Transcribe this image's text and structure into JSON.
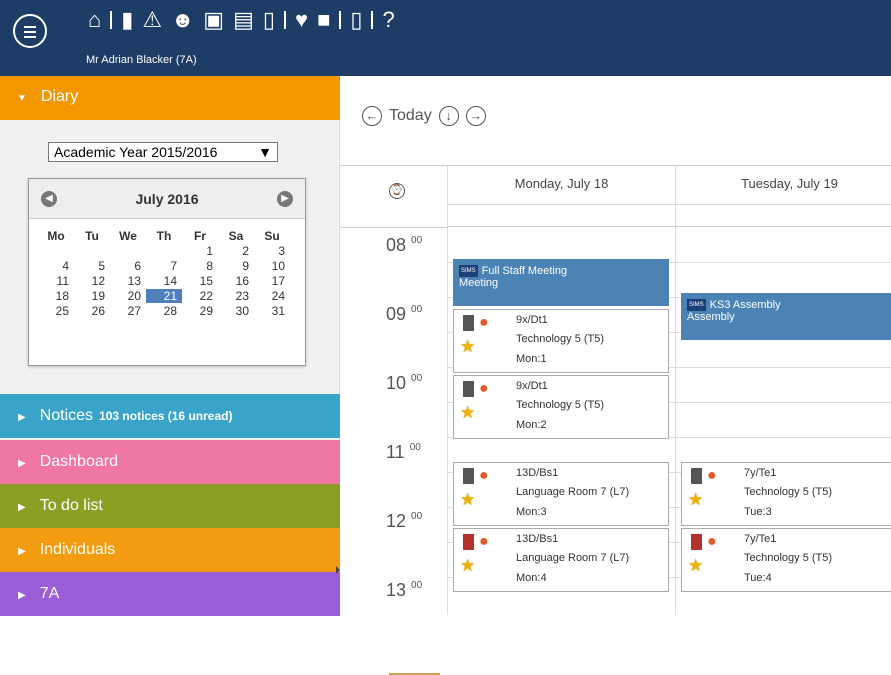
{
  "header": {
    "user": "Mr Adrian Blacker (7A)",
    "icons": [
      "home-icon",
      "book-icon",
      "warning-icon",
      "people-icon",
      "calendar-icon",
      "printer-icon",
      "phone-icon",
      "heart-icon",
      "square-icon",
      "door-icon",
      "help-icon"
    ]
  },
  "sidebar": {
    "diary_label": "Diary",
    "academic_year": "Academic Year 2015/2016",
    "calendar": {
      "month": "July 2016",
      "weekdays": [
        "Mo",
        "Tu",
        "We",
        "Th",
        "Fr",
        "Sa",
        "Su"
      ],
      "days": [
        "",
        "",
        "",
        "",
        "1",
        "2",
        "3",
        "4",
        "5",
        "6",
        "7",
        "8",
        "9",
        "10",
        "11",
        "12",
        "13",
        "14",
        "15",
        "16",
        "17",
        "18",
        "19",
        "20",
        "21",
        "22",
        "23",
        "24",
        "25",
        "26",
        "27",
        "28",
        "29",
        "30",
        "31"
      ],
      "selected": "21"
    },
    "notices": {
      "label": "Notices",
      "count": "103 notices (16 unread)"
    },
    "dashboard": "Dashboard",
    "todo": "To do list",
    "individuals": "Individuals",
    "class": "7A"
  },
  "main": {
    "today": "Today",
    "days": [
      "Monday, July 18",
      "Tuesday, July 19"
    ],
    "hours": [
      {
        "hour": "08",
        "minute": "00"
      },
      {
        "hour": "09",
        "minute": "00"
      },
      {
        "hour": "10",
        "minute": "00"
      },
      {
        "hour": "11",
        "minute": "00"
      },
      {
        "hour": "12",
        "minute": "00"
      },
      {
        "hour": "13",
        "minute": "00"
      }
    ],
    "events": {
      "staff_meeting": {
        "title": "Full Staff Meeting",
        "subtitle": "Meeting"
      },
      "assembly": {
        "title": "KS3 Assembly",
        "subtitle": "Assembly"
      },
      "lesson1": {
        "group": "9x/Dt1",
        "room": "Technology 5 (T5)",
        "period": "Mon:1"
      },
      "lesson2": {
        "group": "9x/Dt1",
        "room": "Technology 5 (T5)",
        "period": "Mon:2"
      },
      "lesson3": {
        "group": "13D/Bs1",
        "room": "Language Room 7 (L7)",
        "period": "Mon:3"
      },
      "lesson4": {
        "group": "13D/Bs1",
        "room": "Language Room 7 (L7)",
        "period": "Mon:4"
      },
      "lesson5": {
        "group": "7y/Te1",
        "room": "Technology 5 (T5)",
        "period": "Tue:3"
      },
      "lesson6": {
        "group": "7y/Te1",
        "room": "Technology 5 (T5)",
        "period": "Tue:4"
      }
    }
  }
}
